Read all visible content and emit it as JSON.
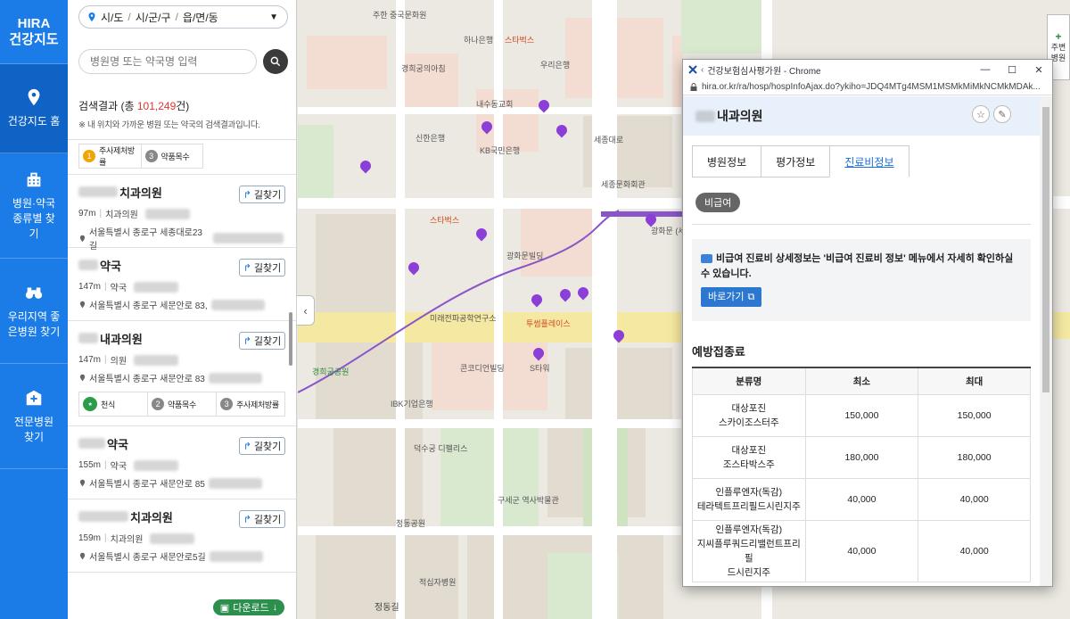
{
  "brand": {
    "line1": "HIRA",
    "line2": "건강지도"
  },
  "rail": [
    {
      "label": "건강지도 홈",
      "icon": "map-pin-icon"
    },
    {
      "label": "병원·약국 종류별 찾기",
      "icon": "building-icon"
    },
    {
      "label": "우리지역 좋은병원 찾기",
      "icon": "binoculars-icon"
    },
    {
      "label": "전문병원 찾기",
      "icon": "hospital-icon"
    }
  ],
  "region": {
    "sido": "시/도",
    "sigungu": "시/군/구",
    "dong": "읍/면/동"
  },
  "search": {
    "placeholder": "병원명 또는 약국명 입력"
  },
  "results": {
    "prefix": "검색결과 (총 ",
    "count": "101,249",
    "suffix": "건)",
    "note": "※ 내 위치와 가까운 병원 또는 약국의 검색결과입니다."
  },
  "top_tags": [
    "주사제처방률",
    "약품목수"
  ],
  "directions_label": "길찾기",
  "cards": [
    {
      "name": "치과의원",
      "distance": "97m",
      "type": "치과의원",
      "address": "서울특별시 종로구 세종대로23길"
    },
    {
      "name": "약국",
      "distance": "147m",
      "type": "약국",
      "address": "서울특별시 종로구 세문안로 83,"
    },
    {
      "name": "내과의원",
      "distance": "147m",
      "type": "의원",
      "address": "서울특별시 종로구 새문안로 83",
      "tags": [
        {
          "badge": "",
          "text": "천식"
        },
        {
          "badge": "2",
          "text": "약품목수"
        },
        {
          "badge": "3",
          "text": "주사제처방률"
        }
      ]
    },
    {
      "name": "약국",
      "distance": "155m",
      "type": "약국",
      "address": "서울특별시 종로구 새문안로 85"
    },
    {
      "name": "치과의원",
      "distance": "159m",
      "type": "치과의원",
      "address": "서울특별시 종로구 새문안로5길"
    }
  ],
  "download_label": "다운로드",
  "map_labels": [
    {
      "text": "주한 중국문화원",
      "cls": ""
    },
    {
      "text": "하나은행",
      "cls": ""
    },
    {
      "text": "스타벅스",
      "cls": "red"
    },
    {
      "text": "우리은행",
      "cls": ""
    },
    {
      "text": "신한은행",
      "cls": ""
    },
    {
      "text": "KB국민은행",
      "cls": ""
    },
    {
      "text": "세종문화회관",
      "cls": ""
    },
    {
      "text": "광화문빌딩",
      "cls": ""
    },
    {
      "text": "투썸플레이스",
      "cls": "red"
    },
    {
      "text": "미래전파공학연구소",
      "cls": ""
    },
    {
      "text": "경희궁의아침",
      "cls": ""
    },
    {
      "text": "내수동교회",
      "cls": ""
    },
    {
      "text": "콘코디언빌딩",
      "cls": ""
    },
    {
      "text": "S타워",
      "cls": ""
    },
    {
      "text": "IBK기업은행",
      "cls": ""
    },
    {
      "text": "덕수궁 디펠리스",
      "cls": ""
    },
    {
      "text": "정동공원",
      "cls": ""
    },
    {
      "text": "구세군 역사박물관",
      "cls": ""
    },
    {
      "text": "정동길",
      "cls": ""
    },
    {
      "text": "세종대로",
      "cls": ""
    },
    {
      "text": "광화문 (세종문화회관)",
      "cls": ""
    },
    {
      "text": "스타벅스",
      "cls": "red"
    },
    {
      "text": "경희궁공원",
      "cls": "green"
    },
    {
      "text": "적십자병원",
      "cls": ""
    }
  ],
  "zoom_ctl": {
    "label": "주변 병원"
  },
  "popup": {
    "window_title": "건강보험심사평가원 - Chrome",
    "url": "hira.or.kr/ra/hosp/hospInfoAjax.do?ykiho=JDQ4MTg4MSM1MSMkMiMkNCMkMDAk...",
    "hospital_name": "내과의원",
    "tabs": [
      "병원정보",
      "평가정보",
      "진료비정보"
    ],
    "active_tab": 2,
    "chip": "비급여",
    "info_text": "비급여 진료비 상세정보는 '비급여 진료비 정보' 메뉴에서 자세히 확인하실 수 있습니다.",
    "go_label": "바로가기",
    "section_title": "예방접종료",
    "table": {
      "headers": [
        "분류명",
        "최소",
        "최대"
      ],
      "rows": [
        {
          "name1": "대상포진",
          "name2": "스카이조스터주",
          "name3": "",
          "min": "150,000",
          "max": "150,000"
        },
        {
          "name1": "대상포진",
          "name2": "조스타박스주",
          "name3": "",
          "min": "180,000",
          "max": "180,000"
        },
        {
          "name1": "인플루엔자(독감)",
          "name2": "테라텍트프리필드시린지주",
          "name3": "",
          "min": "40,000",
          "max": "40,000"
        },
        {
          "name1": "인플루엔자(독감)",
          "name2": "지씨플루쿼드리밸런트프리필",
          "name3": "드시린지주",
          "min": "40,000",
          "max": "40,000"
        }
      ]
    }
  }
}
